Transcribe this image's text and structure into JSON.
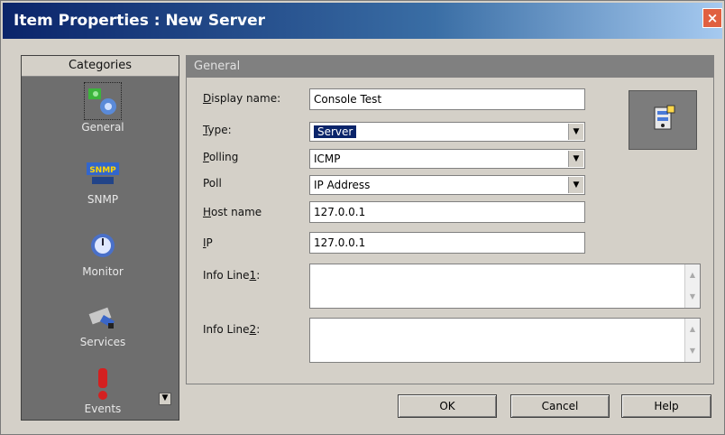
{
  "window": {
    "title": "Item Properties : New Server",
    "close_glyph": "×"
  },
  "categories": {
    "header": "Categories",
    "items": [
      {
        "label": "General",
        "icon": "general-icon",
        "selected": true
      },
      {
        "label": "SNMP",
        "icon": "snmp-icon"
      },
      {
        "label": "Monitor",
        "icon": "monitor-icon"
      },
      {
        "label": "Services",
        "icon": "services-icon"
      },
      {
        "label": "Events",
        "icon": "events-icon"
      }
    ],
    "snmp_icon_text": "SNMP",
    "scroll_glyph": "▼"
  },
  "general": {
    "header": "General",
    "display_name": {
      "label_pre": "",
      "accel": "D",
      "label_post": "isplay name:",
      "value": "Console Test"
    },
    "type": {
      "accel": "T",
      "label_post": "ype:",
      "value": "Server"
    },
    "polling": {
      "accel": "P",
      "label_post": "olling",
      "value": "ICMP"
    },
    "poll": {
      "label": "Poll",
      "value": "IP Address"
    },
    "host_name": {
      "accel": "H",
      "label_post": "ost name",
      "value": "127.0.0.1"
    },
    "ip": {
      "accel": "I",
      "label_post": "P",
      "value": "127.0.0.1"
    },
    "info_line1": {
      "label_pre": "Info Line",
      "accel": "1",
      "label_post": ":"
    },
    "info_line2": {
      "label_pre": "Info Line",
      "accel": "2",
      "label_post": ":"
    },
    "dropdown_glyph": "▼",
    "scroll_up": "▲",
    "scroll_down": "▼"
  },
  "buttons": {
    "ok": "OK",
    "cancel": "Cancel",
    "help": "Help"
  }
}
